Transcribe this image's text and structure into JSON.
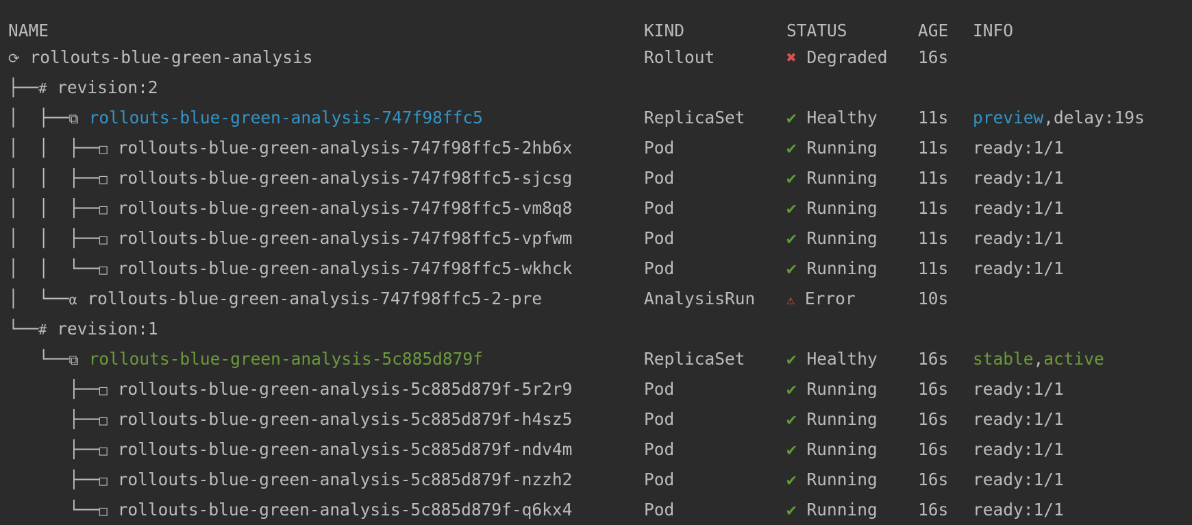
{
  "headers": {
    "name": "NAME",
    "kind": "KIND",
    "status": "STATUS",
    "age": "AGE",
    "info": "INFO"
  },
  "rows": [
    {
      "tree": "",
      "icon": "⟳",
      "label": "rollouts-blue-green-analysis",
      "label_color": "default",
      "kind": "Rollout",
      "status_icon": "✖",
      "status_icon_color": "bad",
      "status": "Degraded",
      "age": "16s",
      "info": []
    },
    {
      "tree": "├──",
      "icon": "#",
      "label": "revision:2",
      "label_color": "default",
      "kind": "",
      "status_icon": "",
      "status_icon_color": "",
      "status": "",
      "age": "",
      "info": []
    },
    {
      "tree": "│  ├──",
      "icon": "⧉",
      "label": "rollouts-blue-green-analysis-747f98ffc5",
      "label_color": "blue",
      "kind": "ReplicaSet",
      "status_icon": "✔",
      "status_icon_color": "ok",
      "status": "Healthy",
      "age": "11s",
      "info": [
        {
          "text": "preview",
          "color": "blue"
        },
        {
          "text": ",",
          "color": "default"
        },
        {
          "text": "delay:19s",
          "color": "default"
        }
      ]
    },
    {
      "tree": "│  │  ├──",
      "icon": "□",
      "label": "rollouts-blue-green-analysis-747f98ffc5-2hb6x",
      "label_color": "default",
      "kind": "Pod",
      "status_icon": "✔",
      "status_icon_color": "ok",
      "status": "Running",
      "age": "11s",
      "info": [
        {
          "text": "ready:1/1",
          "color": "default"
        }
      ]
    },
    {
      "tree": "│  │  ├──",
      "icon": "□",
      "label": "rollouts-blue-green-analysis-747f98ffc5-sjcsg",
      "label_color": "default",
      "kind": "Pod",
      "status_icon": "✔",
      "status_icon_color": "ok",
      "status": "Running",
      "age": "11s",
      "info": [
        {
          "text": "ready:1/1",
          "color": "default"
        }
      ]
    },
    {
      "tree": "│  │  ├──",
      "icon": "□",
      "label": "rollouts-blue-green-analysis-747f98ffc5-vm8q8",
      "label_color": "default",
      "kind": "Pod",
      "status_icon": "✔",
      "status_icon_color": "ok",
      "status": "Running",
      "age": "11s",
      "info": [
        {
          "text": "ready:1/1",
          "color": "default"
        }
      ]
    },
    {
      "tree": "│  │  ├──",
      "icon": "□",
      "label": "rollouts-blue-green-analysis-747f98ffc5-vpfwm",
      "label_color": "default",
      "kind": "Pod",
      "status_icon": "✔",
      "status_icon_color": "ok",
      "status": "Running",
      "age": "11s",
      "info": [
        {
          "text": "ready:1/1",
          "color": "default"
        }
      ]
    },
    {
      "tree": "│  │  └──",
      "icon": "□",
      "label": "rollouts-blue-green-analysis-747f98ffc5-wkhck",
      "label_color": "default",
      "kind": "Pod",
      "status_icon": "✔",
      "status_icon_color": "ok",
      "status": "Running",
      "age": "11s",
      "info": [
        {
          "text": "ready:1/1",
          "color": "default"
        }
      ]
    },
    {
      "tree": "│  └──",
      "icon": "α",
      "label": "rollouts-blue-green-analysis-747f98ffc5-2-pre",
      "label_color": "default",
      "kind": "AnalysisRun",
      "status_icon": "⚠",
      "status_icon_color": "warn",
      "status": "Error",
      "age": "10s",
      "info": []
    },
    {
      "tree": "└──",
      "icon": "#",
      "label": "revision:1",
      "label_color": "default",
      "kind": "",
      "status_icon": "",
      "status_icon_color": "",
      "status": "",
      "age": "",
      "info": []
    },
    {
      "tree": "   └──",
      "icon": "⧉",
      "label": "rollouts-blue-green-analysis-5c885d879f",
      "label_color": "green",
      "kind": "ReplicaSet",
      "status_icon": "✔",
      "status_icon_color": "ok",
      "status": "Healthy",
      "age": "16s",
      "info": [
        {
          "text": "stable",
          "color": "green"
        },
        {
          "text": ",",
          "color": "default"
        },
        {
          "text": "active",
          "color": "green"
        }
      ]
    },
    {
      "tree": "      ├──",
      "icon": "□",
      "label": "rollouts-blue-green-analysis-5c885d879f-5r2r9",
      "label_color": "default",
      "kind": "Pod",
      "status_icon": "✔",
      "status_icon_color": "ok",
      "status": "Running",
      "age": "16s",
      "info": [
        {
          "text": "ready:1/1",
          "color": "default"
        }
      ]
    },
    {
      "tree": "      ├──",
      "icon": "□",
      "label": "rollouts-blue-green-analysis-5c885d879f-h4sz5",
      "label_color": "default",
      "kind": "Pod",
      "status_icon": "✔",
      "status_icon_color": "ok",
      "status": "Running",
      "age": "16s",
      "info": [
        {
          "text": "ready:1/1",
          "color": "default"
        }
      ]
    },
    {
      "tree": "      ├──",
      "icon": "□",
      "label": "rollouts-blue-green-analysis-5c885d879f-ndv4m",
      "label_color": "default",
      "kind": "Pod",
      "status_icon": "✔",
      "status_icon_color": "ok",
      "status": "Running",
      "age": "16s",
      "info": [
        {
          "text": "ready:1/1",
          "color": "default"
        }
      ]
    },
    {
      "tree": "      ├──",
      "icon": "□",
      "label": "rollouts-blue-green-analysis-5c885d879f-nzzh2",
      "label_color": "default",
      "kind": "Pod",
      "status_icon": "✔",
      "status_icon_color": "ok",
      "status": "Running",
      "age": "16s",
      "info": [
        {
          "text": "ready:1/1",
          "color": "default"
        }
      ]
    },
    {
      "tree": "      └──",
      "icon": "□",
      "label": "rollouts-blue-green-analysis-5c885d879f-q6kx4",
      "label_color": "default",
      "kind": "Pod",
      "status_icon": "✔",
      "status_icon_color": "ok",
      "status": "Running",
      "age": "16s",
      "info": [
        {
          "text": "ready:1/1",
          "color": "default"
        }
      ]
    }
  ],
  "colors": {
    "background": "#2b2b2b",
    "text": "#bbbbbb",
    "blue": "#3592c4",
    "green": "#6a9a3a",
    "ok": "#5e9c37",
    "bad": "#d9534f"
  }
}
